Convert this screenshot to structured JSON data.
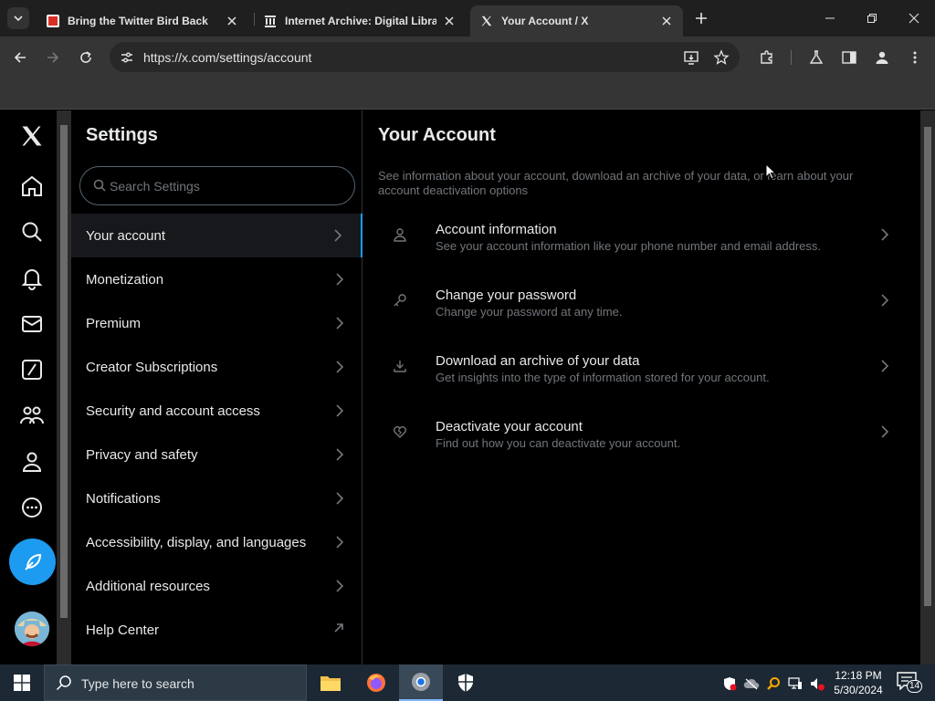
{
  "browser": {
    "tabs": [
      {
        "title": "Bring the Twitter Bird Back",
        "favicon": "red-extension-icon"
      },
      {
        "title": "Internet Archive: Digital Library",
        "favicon": "archive-icon"
      },
      {
        "title": "Your Account / X",
        "favicon": "x-logo-icon"
      }
    ],
    "url": "https://x.com/settings/account"
  },
  "settings": {
    "title": "Settings",
    "search_placeholder": "Search Settings",
    "items": [
      {
        "label": "Your account"
      },
      {
        "label": "Monetization"
      },
      {
        "label": "Premium"
      },
      {
        "label": "Creator Subscriptions"
      },
      {
        "label": "Security and account access"
      },
      {
        "label": "Privacy and safety"
      },
      {
        "label": "Notifications"
      },
      {
        "label": "Accessibility, display, and languages"
      },
      {
        "label": "Additional resources"
      },
      {
        "label": "Help Center"
      }
    ]
  },
  "account": {
    "title": "Your Account",
    "description": "See information about your account, download an archive of your data, or learn about your account deactivation options",
    "options": [
      {
        "title": "Account information",
        "subtitle": "See your account information like your phone number and email address."
      },
      {
        "title": "Change your password",
        "subtitle": "Change your password at any time."
      },
      {
        "title": "Download an archive of your data",
        "subtitle": "Get insights into the type of information stored for your account."
      },
      {
        "title": "Deactivate your account",
        "subtitle": "Find out how you can deactivate your account."
      }
    ]
  },
  "taskbar": {
    "search_placeholder": "Type here to search",
    "time": "12:18 PM",
    "date": "5/30/2024",
    "notification_count": "14"
  },
  "colors": {
    "accent": "#1d9bf0",
    "background": "#000000",
    "text_primary": "#e7e9ea",
    "text_secondary": "#71767b"
  }
}
